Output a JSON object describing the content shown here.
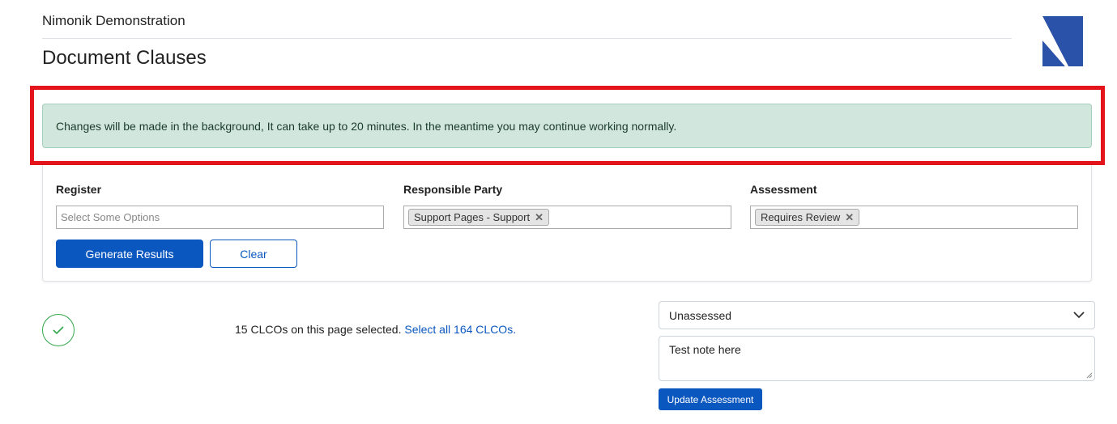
{
  "header": {
    "org_name": "Nimonik Demonstration",
    "page_title": "Document Clauses",
    "logo_icon": "nimonik-logo",
    "brand_color": "#2a52a8"
  },
  "alert": {
    "message": "Changes will be made in the background, It can take up to 20 minutes. In the meantime you may continue working normally.",
    "color": "#d1e7dd",
    "highlight_color": "#e3141c"
  },
  "filters": {
    "register": {
      "label": "Register",
      "placeholder": "Select Some Options"
    },
    "responsible_party": {
      "label": "Responsible Party",
      "selected": [
        "Support Pages - Support"
      ]
    },
    "assessment": {
      "label": "Assessment",
      "selected": [
        "Requires Review"
      ]
    },
    "generate_label": "Generate Results",
    "clear_label": "Clear"
  },
  "selection": {
    "text": "15 CLCOs on this page selected.",
    "select_all_label": "Select all 164 CLCOs.",
    "icon": "check-icon"
  },
  "assessment_form": {
    "selected_value": "Unassessed",
    "note_value": "Test note here",
    "update_label": "Update Assessment"
  },
  "colors": {
    "primary": "#0b57c0",
    "success": "#2ea84a"
  }
}
